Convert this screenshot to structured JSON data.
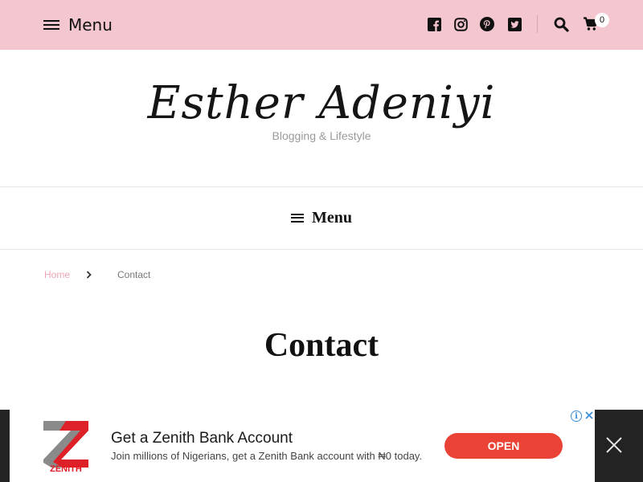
{
  "topbar": {
    "menu_label": "Menu",
    "social_icons": [
      "facebook-icon",
      "instagram-icon",
      "pinterest-icon",
      "twitter-icon"
    ],
    "cart_count": "0",
    "background_color": "#f4c6cf"
  },
  "header": {
    "site_title": "Esther Adeniyi",
    "tagline": "Blogging & Lifestyle"
  },
  "secondary_nav": {
    "menu_label": "Menu"
  },
  "breadcrumb": {
    "home": "Home",
    "current": "Contact",
    "home_color": "#f0a2b2"
  },
  "page": {
    "title": "Contact"
  },
  "ad": {
    "brand": "ZENITH",
    "title": "Get a Zenith Bank Account",
    "description": "Join millions of Nigerians, get a Zenith Bank account with ₦0 today.",
    "cta": "OPEN",
    "cta_color": "#ea4335",
    "info_glyph": "i"
  }
}
